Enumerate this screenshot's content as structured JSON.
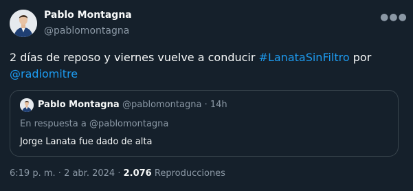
{
  "author": {
    "name": "Pablo Montagna",
    "handle": "@pablomontagna"
  },
  "tweet": {
    "text_before": "2 días de reposo y viernes vuelve a conducir ",
    "hashtag": "#LanataSinFiltro",
    "text_middle": " por",
    "mention": "@radiomitre"
  },
  "quote": {
    "name": "Pablo Montagna",
    "handle": "@pablomontagna",
    "separator": "·",
    "time": "14h",
    "reply_label": "En respuesta a @pablomontagna",
    "text": "Jorge Lanata fue dado de alta"
  },
  "footer": {
    "time": "6:19 p. m.",
    "sep1": "·",
    "date": "2 abr. 2024",
    "sep2": "·",
    "views_count": "2.076",
    "views_label": "Reproducciones"
  },
  "icons": {
    "more": "more-horizontal-icon"
  },
  "colors": {
    "background": "#15202b",
    "link": "#1d9bf0",
    "text": "#f7f9f9",
    "secondary": "#8b98a5",
    "border": "#38444d"
  }
}
